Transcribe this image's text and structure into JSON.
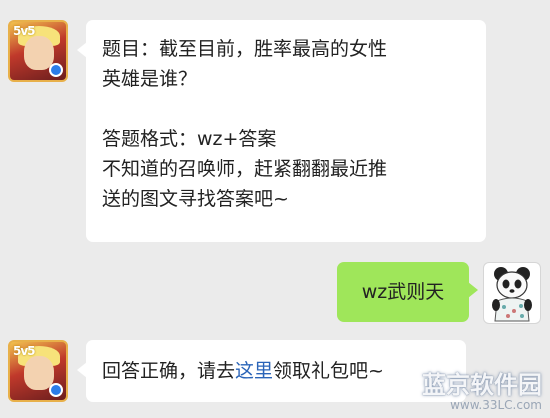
{
  "messages": [
    {
      "sender": "game-account",
      "avatar_text": "5v5",
      "lines": [
        "题目：截至目前，胜率最高的女性",
        "英雄是谁？",
        "",
        "答题格式：wz+答案",
        "不知道的召唤师，赶紧翻翻最近推",
        "送的图文寻找答案吧~"
      ]
    },
    {
      "sender": "user",
      "text": "wz武则天"
    },
    {
      "sender": "game-account",
      "avatar_text": "5v5",
      "text_before": "回答正确，请去",
      "link_text": "这里",
      "text_after": "领取礼包吧~"
    }
  ],
  "watermark": {
    "main": "蓝京软件园",
    "url": "www.33LC.com"
  },
  "colors": {
    "background": "#ebebeb",
    "bubble_incoming": "#ffffff",
    "bubble_outgoing": "#9fe65a",
    "link": "#2a64b8"
  }
}
